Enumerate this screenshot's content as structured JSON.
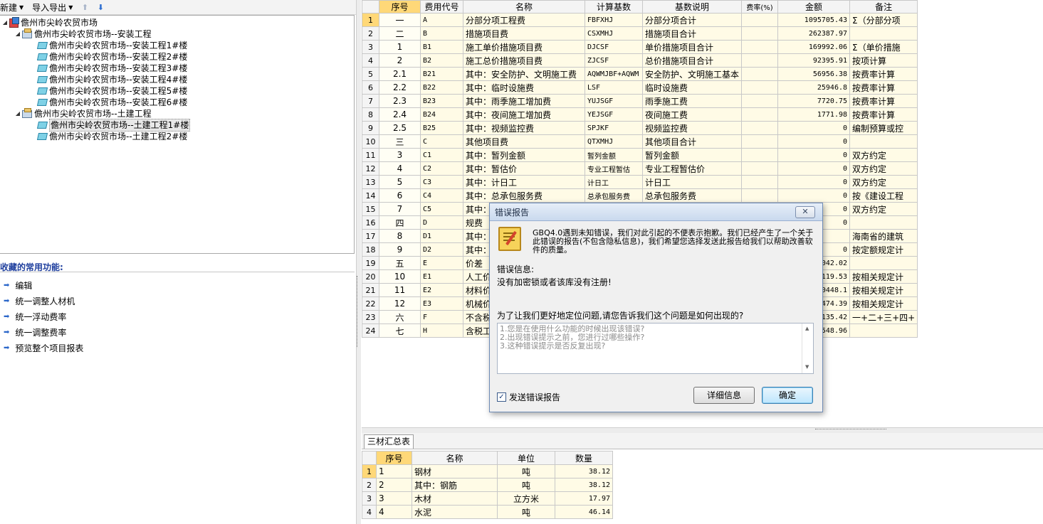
{
  "toolbar": {
    "new_label": "新建",
    "import_export_label": "导入导出",
    "move_up_icon": "arrow-up-icon",
    "move_down_icon": "arrow-down-icon"
  },
  "tree": {
    "root": "儋州市尖岭农贸市场",
    "nodes": [
      {
        "label": "儋州市尖岭农贸市场--安装工程"
      },
      {
        "label": "儋州市尖岭农贸市场--安装工程1#楼"
      },
      {
        "label": "儋州市尖岭农贸市场--安装工程2#楼"
      },
      {
        "label": "儋州市尖岭农贸市场--安装工程3#楼"
      },
      {
        "label": "儋州市尖岭农贸市场--安装工程4#楼"
      },
      {
        "label": "儋州市尖岭农贸市场--安装工程5#楼"
      },
      {
        "label": "儋州市尖岭农贸市场--安装工程6#楼"
      },
      {
        "label": "儋州市尖岭农贸市场--土建工程"
      },
      {
        "label": "儋州市尖岭农贸市场--土建工程1#楼"
      },
      {
        "label": "儋州市尖岭农贸市场--土建工程2#楼"
      }
    ]
  },
  "favorites": {
    "title": "收藏的常用功能:",
    "items": [
      "编辑",
      "统一调整人材机",
      "统一浮动费率",
      "统一调整费率",
      "预览整个项目报表"
    ]
  },
  "main_table": {
    "headers": [
      "序号",
      "费用代号",
      "名称",
      "计算基数",
      "基数说明",
      "费率(%)",
      "金额",
      "备注"
    ],
    "rows": [
      {
        "n": "1",
        "seq": "一",
        "code": "A",
        "name": "分部分项工程费",
        "base": "FBFXHJ",
        "desc": "分部分项合计",
        "rate": "",
        "amount": "1095705.43",
        "note": "Σ（分部分项"
      },
      {
        "n": "2",
        "seq": "二",
        "code": "B",
        "name": "措施项目费",
        "base": "CSXMHJ",
        "desc": "措施项目合计",
        "rate": "",
        "amount": "262387.97",
        "note": ""
      },
      {
        "n": "3",
        "seq": "1",
        "code": "B1",
        "name": "施工单价措施项目费",
        "base": "DJCSF",
        "desc": "单价措施项目合计",
        "rate": "",
        "amount": "169992.06",
        "note": "Σ（单价措施"
      },
      {
        "n": "4",
        "seq": "2",
        "code": "B2",
        "name": "施工总价措施项目费",
        "base": "ZJCSF",
        "desc": "总价措施项目合计",
        "rate": "",
        "amount": "92395.91",
        "note": "按项计算"
      },
      {
        "n": "5",
        "seq": "2.1",
        "code": "B21",
        "name": "其中：安全防护、文明施工费",
        "base": "AQWMJBF+AQWM",
        "desc": "安全防护、文明施工基本",
        "rate": "",
        "amount": "56956.38",
        "note": "按费率计算"
      },
      {
        "n": "6",
        "seq": "2.2",
        "code": "B22",
        "name": "其中：临时设施费",
        "base": "LSF",
        "desc": "临时设施费",
        "rate": "",
        "amount": "25946.8",
        "note": "按费率计算"
      },
      {
        "n": "7",
        "seq": "2.3",
        "code": "B23",
        "name": "其中：雨季施工增加费",
        "base": "YUJSGF",
        "desc": "雨季施工费",
        "rate": "",
        "amount": "7720.75",
        "note": "按费率计算"
      },
      {
        "n": "8",
        "seq": "2.4",
        "code": "B24",
        "name": "其中：夜间施工增加费",
        "base": "YEJSGF",
        "desc": "夜间施工费",
        "rate": "",
        "amount": "1771.98",
        "note": "按费率计算"
      },
      {
        "n": "9",
        "seq": "2.5",
        "code": "B25",
        "name": "其中：视频监控费",
        "base": "SPJKF",
        "desc": "视频监控费",
        "rate": "",
        "amount": "0",
        "note": "编制预算或控"
      },
      {
        "n": "10",
        "seq": "三",
        "code": "C",
        "name": "其他项目费",
        "base": "QTXMHJ",
        "desc": "其他项目合计",
        "rate": "",
        "amount": "0",
        "note": ""
      },
      {
        "n": "11",
        "seq": "3",
        "code": "C1",
        "name": "其中：暂列金额",
        "base": "暂列金额",
        "desc": "暂列金额",
        "rate": "",
        "amount": "0",
        "note": "双方约定"
      },
      {
        "n": "12",
        "seq": "4",
        "code": "C2",
        "name": "其中：暂估价",
        "base": "专业工程暂估",
        "desc": "专业工程暂估价",
        "rate": "",
        "amount": "0",
        "note": "双方约定"
      },
      {
        "n": "13",
        "seq": "5",
        "code": "C3",
        "name": "其中：计日工",
        "base": "计日工",
        "desc": "计日工",
        "rate": "",
        "amount": "0",
        "note": "双方约定"
      },
      {
        "n": "14",
        "seq": "6",
        "code": "C4",
        "name": "其中：总承包服务费",
        "base": "总承包服务费",
        "desc": "总承包服务费",
        "rate": "",
        "amount": "0",
        "note": "按《建设工程"
      },
      {
        "n": "15",
        "seq": "7",
        "code": "C5",
        "name": "其中：",
        "base": "",
        "desc": "",
        "rate": "",
        "amount": "0",
        "note": "双方约定"
      },
      {
        "n": "16",
        "seq": "四",
        "code": "D",
        "name": "规费",
        "base": "",
        "desc": "",
        "rate": "",
        "amount": "0",
        "note": ""
      },
      {
        "n": "17",
        "seq": "8",
        "code": "D1",
        "name": "其中：",
        "base": "",
        "desc": "",
        "rate": "",
        "amount": "",
        "note": "海南省的建筑"
      },
      {
        "n": "18",
        "seq": "9",
        "code": "D2",
        "name": "其中：",
        "base": "",
        "desc": "",
        "rate": "",
        "amount": "0",
        "note": "按定额规定计"
      },
      {
        "n": "19",
        "seq": "五",
        "code": "E",
        "name": "价差",
        "base": "",
        "desc": "",
        "rate": "",
        "amount": "042.02",
        "note": ""
      },
      {
        "n": "20",
        "seq": "10",
        "code": "E1",
        "name": "人工价",
        "base": "",
        "desc": "",
        "rate": "",
        "amount": "119.53",
        "note": "按相关规定计"
      },
      {
        "n": "21",
        "seq": "11",
        "code": "E2",
        "name": "材料价",
        "base": "",
        "desc": "",
        "rate": "",
        "amount": "0448.1",
        "note": "按相关规定计"
      },
      {
        "n": "22",
        "seq": "12",
        "code": "E3",
        "name": "机械价",
        "base": "",
        "desc": "",
        "rate": "",
        "amount": "474.39",
        "note": "按相关规定计"
      },
      {
        "n": "23",
        "seq": "六",
        "code": "F",
        "name": "不含税",
        "base": "",
        "desc": "",
        "rate": "",
        "amount": "135.42",
        "note": "一+二+三+四+"
      },
      {
        "n": "24",
        "seq": "七",
        "code": "H",
        "name": "含税工",
        "base": "",
        "desc": "",
        "rate": "",
        "amount": "548.96",
        "note": ""
      }
    ]
  },
  "lower_panel": {
    "tab_label": "三材汇总表",
    "headers": [
      "序号",
      "名称",
      "单位",
      "数量"
    ],
    "rows": [
      {
        "n": "1",
        "seq": "1",
        "name": "钢材",
        "unit": "吨",
        "qty": "38.12"
      },
      {
        "n": "2",
        "seq": "2",
        "name": "其中：钢筋",
        "unit": "吨",
        "qty": "38.12"
      },
      {
        "n": "3",
        "seq": "3",
        "name": "木材",
        "unit": "立方米",
        "qty": "17.97"
      },
      {
        "n": "4",
        "seq": "4",
        "name": "水泥",
        "unit": "吨",
        "qty": "46.14"
      }
    ]
  },
  "dialog": {
    "title": "错误报告",
    "close_icon": "close-icon",
    "message": "GBQ4.0遇到未知错误，我们对此引起的不便表示抱歉。我们已经产生了一个关于此错误的报告(不包含隐私信息)，我们希望您选择发送此报告给我们以帮助改善软件的质量。",
    "error_label": "错误信息:",
    "error_text": "没有加密锁或者该库没有注册!",
    "question": "为了让我们更好地定位问题,请您告诉我们这个问题是如何出现的?",
    "hints": [
      "1.您是在使用什么功能的时候出现该错误?",
      "2.出现错误提示之前，您进行过哪些操作?",
      "3.这种错误提示是否反复出现?"
    ],
    "checkbox_label": "发送错误报告",
    "checkbox_checked": true,
    "details_button": "详细信息",
    "ok_button": "确定"
  },
  "colors": {
    "row_fill": "#fffbe6",
    "selected_header": "#ffd878",
    "link_blue": "#1f3f9e"
  }
}
